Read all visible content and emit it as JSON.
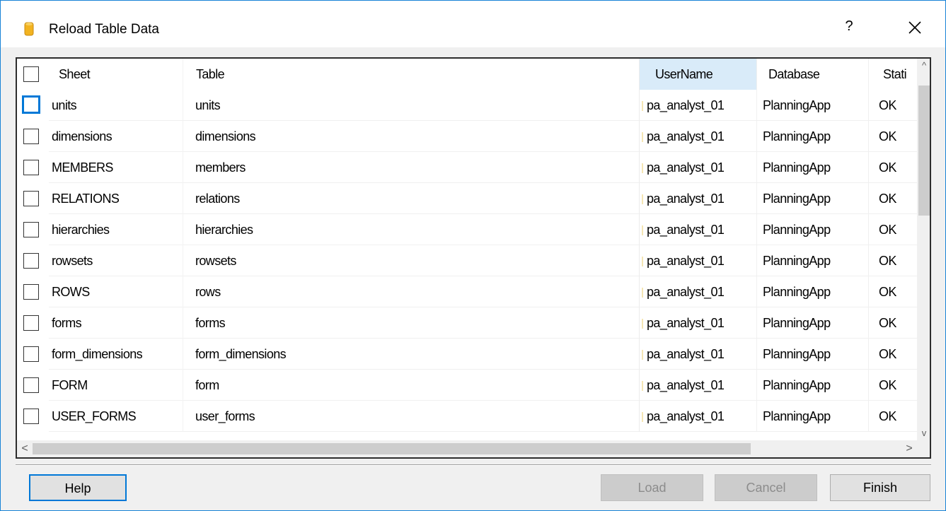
{
  "window": {
    "title": "Reload Table Data",
    "help_glyph": "?",
    "close_glyph": "✕"
  },
  "grid": {
    "columns": [
      "Sheet",
      "Table",
      "UserName",
      "Database",
      "Stati"
    ],
    "rows": [
      {
        "sheet": "units",
        "table": "units",
        "username": "pa_analyst_01",
        "database": "PlanningApp",
        "status": "OK"
      },
      {
        "sheet": "dimensions",
        "table": "dimensions",
        "username": "pa_analyst_01",
        "database": "PlanningApp",
        "status": "OK"
      },
      {
        "sheet": "MEMBERS",
        "table": "members",
        "username": "pa_analyst_01",
        "database": "PlanningApp",
        "status": "OK"
      },
      {
        "sheet": "RELATIONS",
        "table": "relations",
        "username": "pa_analyst_01",
        "database": "PlanningApp",
        "status": "OK"
      },
      {
        "sheet": "hierarchies",
        "table": "hierarchies",
        "username": "pa_analyst_01",
        "database": "PlanningApp",
        "status": "OK"
      },
      {
        "sheet": "rowsets",
        "table": "rowsets",
        "username": "pa_analyst_01",
        "database": "PlanningApp",
        "status": "OK"
      },
      {
        "sheet": "ROWS",
        "table": "rows",
        "username": "pa_analyst_01",
        "database": "PlanningApp",
        "status": "OK"
      },
      {
        "sheet": "forms",
        "table": "forms",
        "username": "pa_analyst_01",
        "database": "PlanningApp",
        "status": "OK"
      },
      {
        "sheet": "form_dimensions",
        "table": "form_dimensions",
        "username": "pa_analyst_01",
        "database": "PlanningApp",
        "status": "OK"
      },
      {
        "sheet": "FORM",
        "table": "form",
        "username": "pa_analyst_01",
        "database": "PlanningApp",
        "status": "OK"
      },
      {
        "sheet": "USER_FORMS",
        "table": "user_forms",
        "username": "pa_analyst_01",
        "database": "PlanningApp",
        "status": "OK"
      }
    ]
  },
  "scroll": {
    "up": "^",
    "down": "v",
    "left": "<",
    "right": ">"
  },
  "buttons": {
    "help": "Help",
    "load": "Load",
    "cancel": "Cancel",
    "finish": "Finish"
  },
  "colors": {
    "accent": "#0078d7",
    "window_border": "#1883d7",
    "selected_header": "#d9ebf9",
    "icon_yellow": "#f2b320"
  }
}
